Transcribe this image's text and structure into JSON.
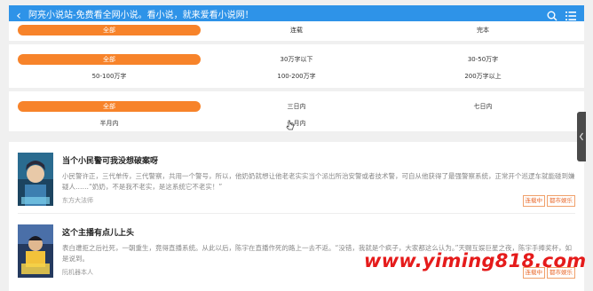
{
  "header": {
    "back_icon": "chevron-left-icon",
    "title": "阿亮小说站-免费看全网小说。看小说，就来爱看小说网！",
    "icons": [
      "search-icon",
      "menu-icon"
    ]
  },
  "filters": {
    "status": {
      "selected": "全部",
      "options": [
        "连载",
        "完本"
      ]
    },
    "words": {
      "selected": "全部",
      "options": [
        "30万字以下",
        "30-50万字",
        "50-100万字",
        "100-200万字",
        "200万字以上"
      ]
    },
    "time": {
      "selected": "全部",
      "options": [
        "三日内",
        "七日内",
        "半月内",
        "一月内"
      ]
    }
  },
  "books": [
    {
      "title": "当个小民警可我没想破案呀",
      "desc": "小民警许正，三代单传，三代警察，共用一个警号，所以，他奶奶就想让他老老实实当个派出所治安警或者技术警，可自从他获得了最强警察系统，正常开个巡逻车就能碰到嫌疑人……“奶奶，不是我不老实，是这系统它不老实！”",
      "author": "东方大法师",
      "tags": [
        "连载中",
        "都市娱乐"
      ]
    },
    {
      "title": "这个主播有点儿上头",
      "desc": "表白遭拒之后社死，一朝重生，竟得直播系统。从此以后，陈宇在直播作死的路上一去不返。“没错，我就是个疯子，大家都这么认为。”天赐互娱巨星之夜，陈宇手捧奖杯，如是说到。",
      "author": "阮机器本人",
      "tags": [
        "连载中",
        "都市娱乐"
      ]
    }
  ],
  "watermark": "www.yiming818.com",
  "colors": {
    "header_bg": "#2e93e8",
    "selected_bg": "#f7832a",
    "tag_text": "#e8682a",
    "watermark": "#e51b1b"
  }
}
